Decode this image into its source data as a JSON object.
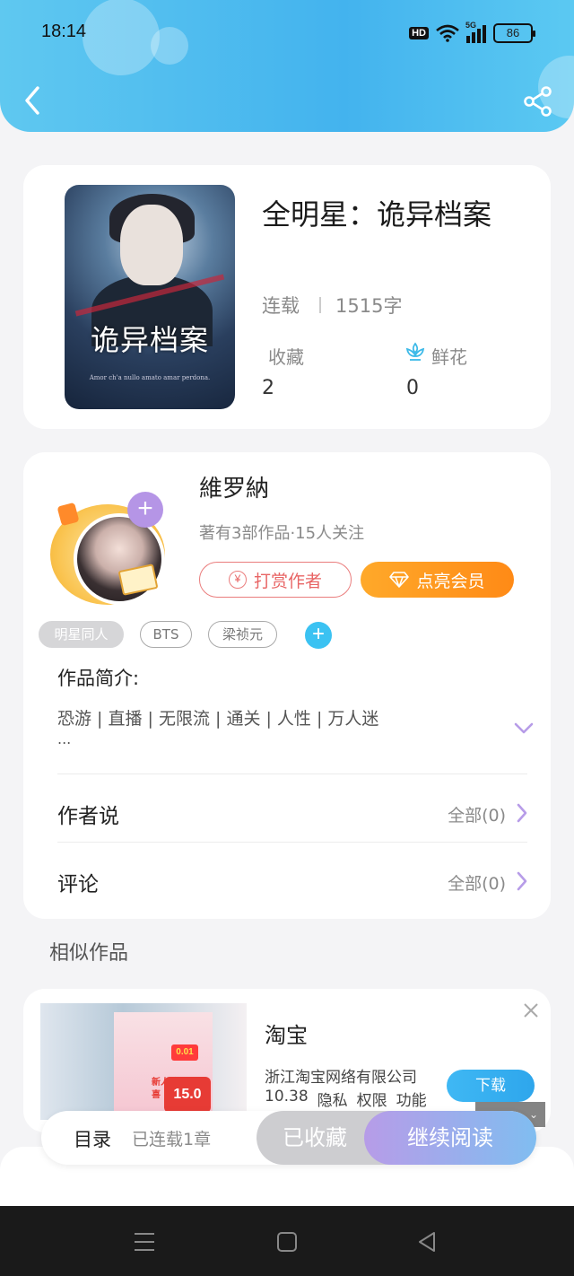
{
  "status_bar": {
    "time": "18:14",
    "hd_label": "HD",
    "network": "5G",
    "battery": "86"
  },
  "header": {
    "back_icon": "chevron-left-icon",
    "share_icon": "share-icon"
  },
  "book": {
    "title": "全明星：诡异档案",
    "cover_title": "诡异档案",
    "cover_small_text": "Amor ch'a nullo amato amar perdona.",
    "status": "连载",
    "word_count": "1515字",
    "favorites_label": "收藏",
    "favorites_value": "2",
    "flowers_label": "鲜花",
    "flowers_value": "0"
  },
  "author": {
    "name": "維罗納",
    "meta": "著有3部作品·15人关注",
    "reward_label": "打赏作者",
    "reward_coin": "¥",
    "vip_label": "点亮会员"
  },
  "tags": [
    {
      "label": "明星同人"
    },
    {
      "label": "BTS"
    },
    {
      "label": "梁祯元"
    }
  ],
  "intro": {
    "label": "作品简介:",
    "text": "恐游 | 直播 | 无限流 | 通关 | 人性 | 万人迷",
    "ellipsis": "..."
  },
  "rows": [
    {
      "label": "作者说",
      "right": "全部(0)"
    },
    {
      "label": "评论",
      "right": "全部(0)"
    }
  ],
  "similar_label": "相似作品",
  "ad": {
    "name": "淘宝",
    "company": "浙江淘宝网络有限公司",
    "version": "10.38",
    "privacy": "隐私",
    "permissions": "权限",
    "features": "功能",
    "download": "下载",
    "img_big": "15.0",
    "img_small": "0.01",
    "img_tag": "新人惊喜"
  },
  "bottom_bar": {
    "toc_label": "目录",
    "toc_sub": "已连载1章",
    "collected": "已收藏",
    "continue": "继续阅读"
  },
  "colors": {
    "header_blue": "#43b3ee",
    "vip_orange": "#ff8a16",
    "reward_red": "#e86565",
    "accent_purple": "#b595e6",
    "download_blue": "#2ea6ec"
  }
}
